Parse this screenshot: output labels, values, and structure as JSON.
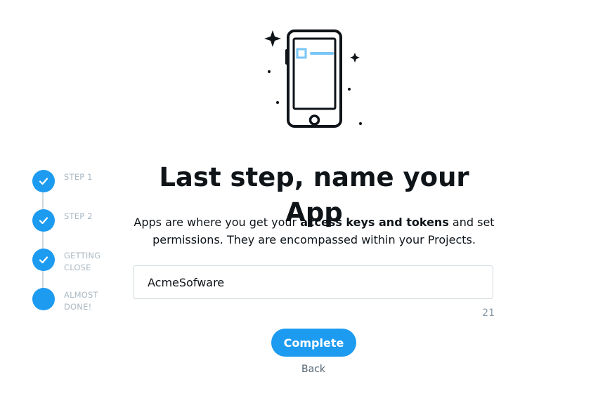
{
  "illustration": {
    "icon": "smartphone-icon"
  },
  "stepper": {
    "steps": [
      {
        "label_line1": "STEP 1",
        "label_line2": "",
        "status": "complete",
        "icon": "checkmark-icon"
      },
      {
        "label_line1": "STEP 2",
        "label_line2": "",
        "status": "complete",
        "icon": "checkmark-icon"
      },
      {
        "label_line1": "GETTING",
        "label_line2": "CLOSE",
        "status": "complete",
        "icon": "checkmark-icon"
      },
      {
        "label_line1": "ALMOST",
        "label_line2": "DONE!",
        "status": "current",
        "icon": ""
      }
    ]
  },
  "main": {
    "title": "Last step, name your App",
    "desc_pre": "Apps are where you get your ",
    "desc_bold": "access keys and tokens",
    "desc_post": " and set permissions. They are encompassed within your Projects.",
    "app_name_value": "AcmeSofware",
    "char_counter": "21",
    "complete_label": "Complete",
    "back_label": "Back"
  },
  "colors": {
    "accent": "#1d9bf0",
    "muted": "#aab8c2",
    "text": "#0f1419"
  }
}
